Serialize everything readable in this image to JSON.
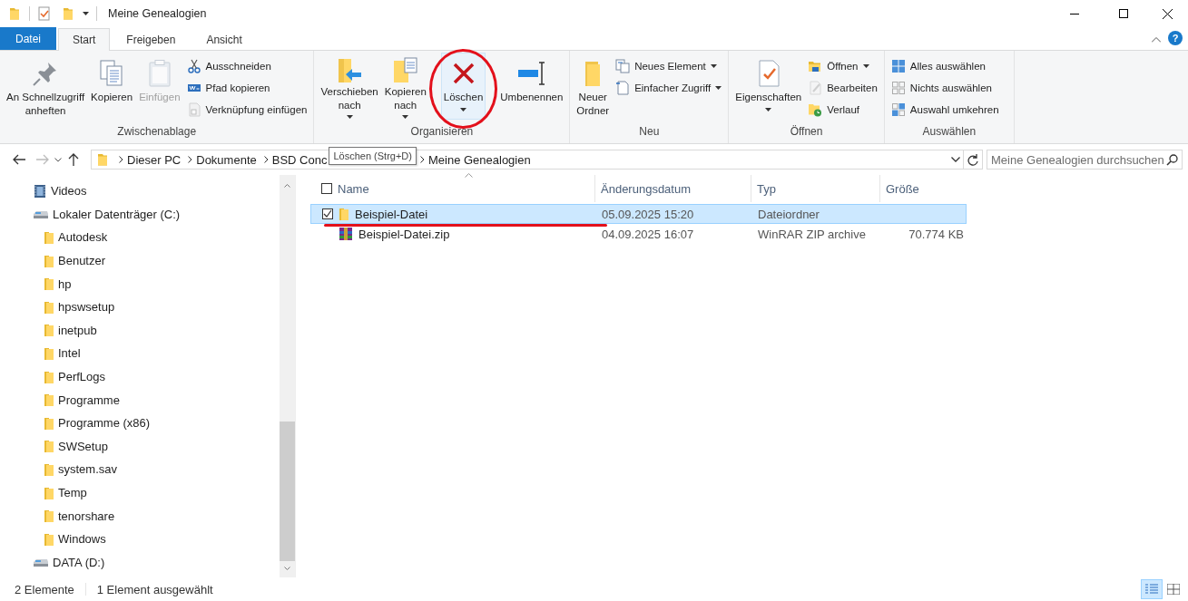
{
  "window": {
    "title": "Meine Genealogien"
  },
  "ribbon_tabs": [
    {
      "label": "Datei",
      "kind": "file",
      "selected": false
    },
    {
      "label": "Start",
      "kind": "tab",
      "selected": true
    },
    {
      "label": "Freigeben",
      "kind": "tab",
      "selected": false
    },
    {
      "label": "Ansicht",
      "kind": "tab",
      "selected": false
    }
  ],
  "help_button": {
    "label": "?"
  },
  "ribbon_groups": [
    {
      "label": "Zwischenablage",
      "large": [
        {
          "label": "An Schnellzugriff\nanheften",
          "dropdown": false,
          "disabled": false,
          "hovered": false,
          "circled": false
        },
        {
          "label": "Kopieren",
          "dropdown": false,
          "disabled": false,
          "hovered": false,
          "circled": false
        },
        {
          "label": "Einfügen",
          "dropdown": false,
          "disabled": true,
          "hovered": false,
          "circled": false
        }
      ],
      "small": [
        {
          "label": "Ausschneiden",
          "dropdown": false,
          "disabled": false
        },
        {
          "label": "Pfad kopieren",
          "dropdown": false,
          "disabled": false
        },
        {
          "label": "Verknüpfung einfügen",
          "dropdown": false,
          "disabled": true
        }
      ]
    },
    {
      "label": "Organisieren",
      "large": [
        {
          "label": "Verschieben\nnach",
          "dropdown": true,
          "disabled": false,
          "hovered": false,
          "circled": false
        },
        {
          "label": "Kopieren\nnach",
          "dropdown": true,
          "disabled": false,
          "hovered": false,
          "circled": false
        },
        {
          "label": "Löschen",
          "dropdown": true,
          "disabled": false,
          "hovered": true,
          "circled": true
        },
        {
          "label": "Umbenennen",
          "dropdown": false,
          "disabled": false,
          "hovered": false,
          "circled": false
        }
      ]
    },
    {
      "label": "Neu",
      "large": [
        {
          "label": "Neuer\nOrdner",
          "dropdown": false,
          "disabled": false,
          "hovered": false,
          "circled": false
        }
      ],
      "small": [
        {
          "label": "Neues Element",
          "dropdown": true,
          "disabled": false
        },
        {
          "label": "Einfacher Zugriff",
          "dropdown": true,
          "disabled": false
        }
      ]
    },
    {
      "label": "Öffnen",
      "large": [
        {
          "label": "Eigenschaften",
          "dropdown": true,
          "disabled": false,
          "hovered": false,
          "circled": false
        }
      ],
      "small": [
        {
          "label": "Öffnen",
          "dropdown": true,
          "disabled": false
        },
        {
          "label": "Bearbeiten",
          "dropdown": false,
          "disabled": true
        },
        {
          "label": "Verlauf",
          "dropdown": false,
          "disabled": false
        }
      ]
    },
    {
      "label": "Auswählen",
      "small": [
        {
          "label": "Alles auswählen",
          "dropdown": false,
          "disabled": false
        },
        {
          "label": "Nichts auswählen",
          "dropdown": false,
          "disabled": false
        },
        {
          "label": "Auswahl umkehren",
          "dropdown": false,
          "disabled": false
        }
      ]
    }
  ],
  "tooltip": {
    "text": "Löschen (Strg+D)"
  },
  "address_bar": {
    "forward_disabled": true,
    "breadcrumb": [
      "Dieser PC",
      "Dokumente",
      "BSD Conc",
      "Meine Genealogien"
    ]
  },
  "search": {
    "placeholder": "Meine Genealogien durchsuchen"
  },
  "sidebar": {
    "items": [
      {
        "label": "Videos",
        "kind": "video"
      },
      {
        "label": "Lokaler Datenträger (C:)",
        "kind": "drive",
        "children": [
          {
            "label": "Autodesk",
            "kind": "folder"
          },
          {
            "label": "Benutzer",
            "kind": "folder"
          },
          {
            "label": "hp",
            "kind": "folder"
          },
          {
            "label": "hpswsetup",
            "kind": "folder"
          },
          {
            "label": "inetpub",
            "kind": "folder"
          },
          {
            "label": "Intel",
            "kind": "folder"
          },
          {
            "label": "PerfLogs",
            "kind": "folder"
          },
          {
            "label": "Programme",
            "kind": "folder"
          },
          {
            "label": "Programme (x86)",
            "kind": "folder"
          },
          {
            "label": "SWSetup",
            "kind": "folder"
          },
          {
            "label": "system.sav",
            "kind": "folder"
          },
          {
            "label": "Temp",
            "kind": "folder"
          },
          {
            "label": "tenorshare",
            "kind": "folder"
          },
          {
            "label": "Windows",
            "kind": "folder"
          }
        ]
      },
      {
        "label": "DATA (D:)",
        "kind": "drive"
      }
    ]
  },
  "file_list": {
    "header_checked": false,
    "columns": [
      "Name",
      "Änderungsdatum",
      "Typ",
      "Größe"
    ],
    "rows": [
      {
        "kind": "folder",
        "name": "Beispiel-Datei",
        "modified": "05.09.2025 15:20",
        "type": "Dateiordner",
        "size": "",
        "selected": true,
        "checked": true,
        "underlined": true
      },
      {
        "kind": "zip",
        "name": "Beispiel-Datei.zip",
        "modified": "04.09.2025 16:07",
        "type": "WinRAR ZIP archive",
        "size": "70.774 KB",
        "selected": false,
        "checked": false,
        "underlined": false
      }
    ]
  },
  "status_bar": [
    "2 Elemente",
    "1 Element ausgewählt"
  ]
}
